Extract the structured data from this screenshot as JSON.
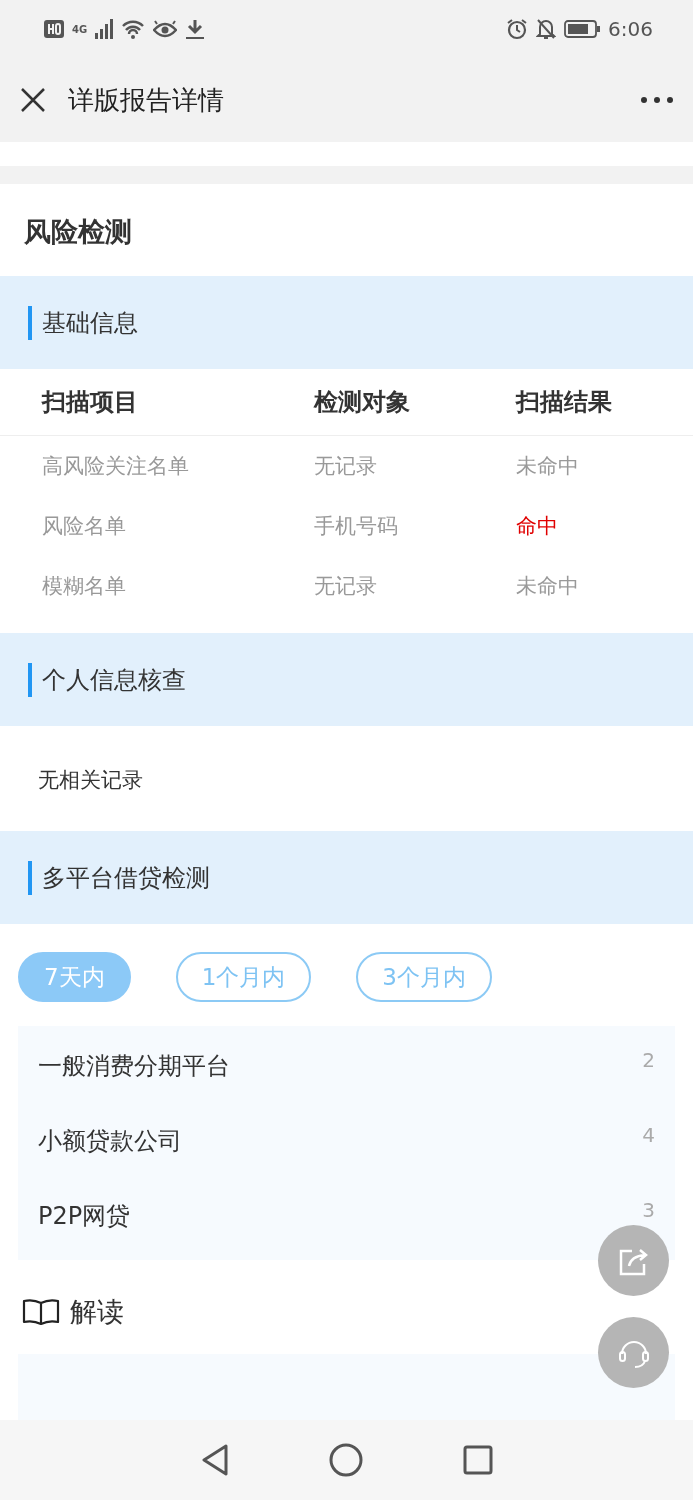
{
  "status_bar": {
    "time": "6:06",
    "network": "4G"
  },
  "header": {
    "title": "详版报告详情"
  },
  "card": {
    "title": "风险检测"
  },
  "basic_info": {
    "title": "基础信息",
    "columns": [
      "扫描项目",
      "检测对象",
      "扫描结果"
    ],
    "rows": [
      {
        "item": "高风险关注名单",
        "target": "无记录",
        "result": "未命中",
        "hit": false
      },
      {
        "item": "风险名单",
        "target": "手机号码",
        "result": "命中",
        "hit": true
      },
      {
        "item": "模糊名单",
        "target": "无记录",
        "result": "未命中",
        "hit": false
      }
    ]
  },
  "personal_check": {
    "title": "个人信息核查",
    "text": "无相关记录"
  },
  "multi_platform": {
    "title": "多平台借贷检测",
    "tabs": [
      {
        "label": "7天内",
        "selected": true
      },
      {
        "label": "1个月内",
        "selected": false
      },
      {
        "label": "3个月内",
        "selected": false
      }
    ],
    "items": [
      {
        "name": "一般消费分期平台",
        "count": "2"
      },
      {
        "name": "小额贷款公司",
        "count": "4"
      },
      {
        "name": "P2P网贷",
        "count": "3"
      }
    ]
  },
  "interpretation": {
    "title": "解读"
  }
}
